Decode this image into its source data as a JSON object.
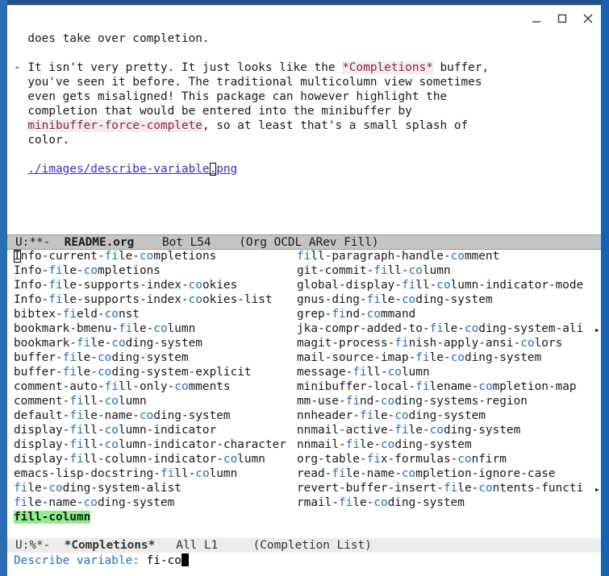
{
  "buffer": {
    "line1": "does take over completion.",
    "line3_pre": "- It isn't very pretty. It just looks like the ",
    "line3_hl": "*Completions*",
    "line3_post": " buffer,",
    "line4": "you've seen it before. The traditional multicolumn view sometimes",
    "line5": "even gets misaligned! This package can however highlight the",
    "line6": "completion that would be entered into the minibuffer by",
    "line7_hl": "minibuffer-force-complete",
    "line7_post": ", so at least that's a small splash of",
    "line8": "color.",
    "link_pre": "./images/describe-variable",
    "link_cursor": ".",
    "link_post": "png"
  },
  "modeline_top": {
    "state": "U:**-",
    "name": "README.org",
    "pos": "Bot L54",
    "modes": "(Org OCDL ARev Fill)"
  },
  "completions": {
    "col1": [
      [
        "Info-current-",
        "fi",
        "le-",
        "co",
        "mpletions"
      ],
      [
        "Info-",
        "fi",
        "le-",
        "co",
        "mpletions"
      ],
      [
        "Info-",
        "fi",
        "le-supports-index-",
        "co",
        "okies"
      ],
      [
        "Info-",
        "fi",
        "le-supports-index-",
        "co",
        "okies-list"
      ],
      [
        "bibtex-",
        "fi",
        "eld-",
        "co",
        "nst"
      ],
      [
        "bookmark-bmenu-",
        "fi",
        "le-",
        "co",
        "lumn"
      ],
      [
        "bookmark-",
        "fi",
        "le-",
        "co",
        "ding-system"
      ],
      [
        "buffer-",
        "fi",
        "le-",
        "co",
        "ding-system"
      ],
      [
        "buffer-",
        "fi",
        "le-",
        "co",
        "ding-system-explicit"
      ],
      [
        "comment-auto-",
        "fi",
        "ll-only-",
        "co",
        "mments"
      ],
      [
        "comment-",
        "fi",
        "ll-",
        "co",
        "lumn"
      ],
      [
        "default-",
        "fi",
        "le-name-",
        "co",
        "ding-system"
      ],
      [
        "display-",
        "fi",
        "ll-",
        "co",
        "lumn-indicator"
      ],
      [
        "display-",
        "fi",
        "ll-",
        "co",
        "lumn-indicator-character"
      ],
      [
        "display-",
        "fi",
        "ll-column-indicator-",
        "co",
        "lumn"
      ],
      [
        "emacs-lisp-docstring-",
        "fi",
        "ll-",
        "co",
        "lumn"
      ],
      [
        "",
        "fi",
        "le-",
        "co",
        "ding-system-alist"
      ],
      [
        "",
        "fi",
        "le-name-",
        "co",
        "ding-system"
      ]
    ],
    "col2": [
      [
        "",
        "fi",
        "ll-paragraph-handle-",
        "co",
        "mment"
      ],
      [
        "git-commit-",
        "fi",
        "ll-",
        "co",
        "lumn"
      ],
      [
        "global-display-",
        "fi",
        "ll-",
        "co",
        "lumn-indicator-mode"
      ],
      [
        "gnus-ding-",
        "fi",
        "le-",
        "co",
        "ding-system"
      ],
      [
        "grep-",
        "fi",
        "nd-",
        "co",
        "mmand"
      ],
      [
        "jka-compr-added-to-",
        "fi",
        "le-",
        "co",
        "ding-system-ali"
      ],
      [
        "magit-process-",
        "fi",
        "nish-apply-ansi-",
        "co",
        "lors"
      ],
      [
        "mail-source-imap-",
        "fi",
        "le-",
        "co",
        "ding-system"
      ],
      [
        "message-",
        "fi",
        "ll-",
        "co",
        "lumn"
      ],
      [
        "minibuffer-local-",
        "fi",
        "lename-",
        "co",
        "mpletion-map"
      ],
      [
        "mm-use-",
        "fi",
        "nd-",
        "co",
        "ding-systems-region"
      ],
      [
        "nnheader-",
        "fi",
        "le-",
        "co",
        "ding-system"
      ],
      [
        "nnmail-active-",
        "fi",
        "le-",
        "co",
        "ding-system"
      ],
      [
        "nnmail-",
        "fi",
        "le-",
        "co",
        "ding-system"
      ],
      [
        "org-table-",
        "fi",
        "x-formulas-",
        "co",
        "nfirm"
      ],
      [
        "read-",
        "fi",
        "le-name-",
        "co",
        "mpletion-ignore-case"
      ],
      [
        "revert-buffer-insert-",
        "fi",
        "le-",
        "co",
        "ntents-functi"
      ],
      [
        "rmail-",
        "fi",
        "le-",
        "co",
        "ding-system"
      ]
    ],
    "selected": "fill-column"
  },
  "modeline_bottom": {
    "state": "U:%*-",
    "name": "*Completions*",
    "pos": "All L1",
    "modes": "(Completion List)"
  },
  "minibuffer": {
    "prompt": "Describe variable: ",
    "input": "fi-co"
  },
  "icons": [
    "minimize-icon",
    "maximize-icon",
    "close-icon"
  ],
  "colors": {
    "match": "#1f6fc5",
    "selected_bg": "#8df08d",
    "link": "#3a2ad0",
    "buffer_name_hl": "#8b2252"
  }
}
